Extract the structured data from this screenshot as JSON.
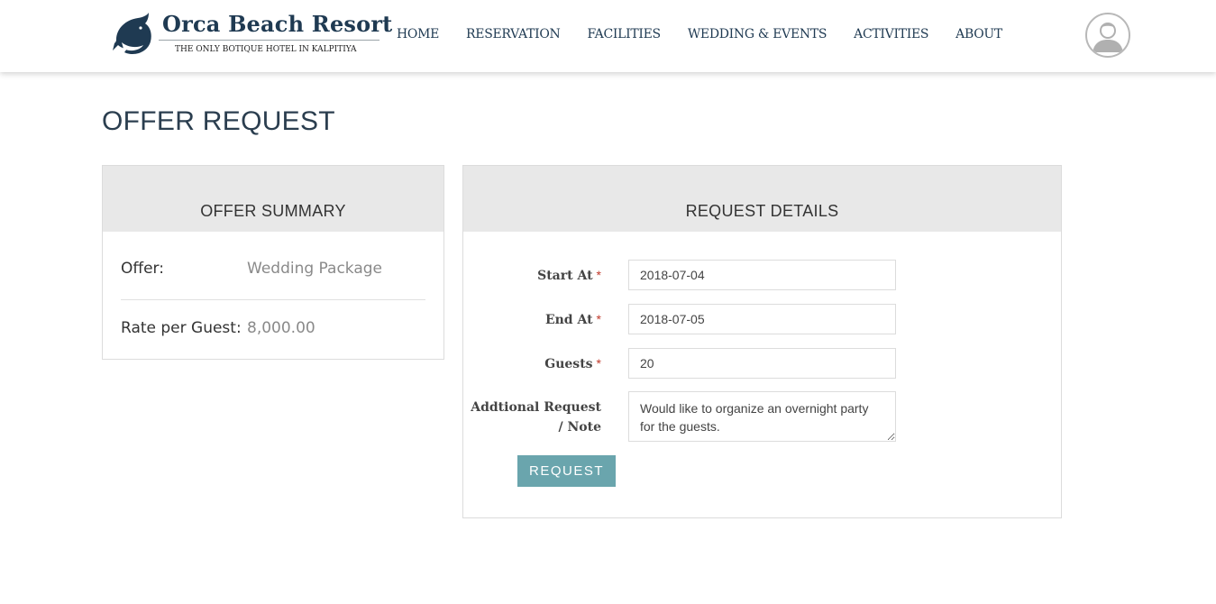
{
  "brand": {
    "name": "Orca Beach Resort",
    "tagline": "THE ONLY BOTIQUE HOTEL IN KALPITIYA",
    "logo_icon": "orca-whale-icon",
    "color": "#1f3a52"
  },
  "nav": {
    "items": [
      {
        "label": "HOME"
      },
      {
        "label": "RESERVATION"
      },
      {
        "label": "FACILITIES"
      },
      {
        "label": "WEDDING & EVENTS"
      },
      {
        "label": "ACTIVITIES"
      },
      {
        "label": "ABOUT"
      }
    ]
  },
  "user": {
    "avatar_icon": "user-avatar-icon"
  },
  "page": {
    "title": "OFFER REQUEST"
  },
  "summary": {
    "heading": "OFFER SUMMARY",
    "offer_label": "Offer:",
    "offer_value": "Wedding Package",
    "rate_label": "Rate per Guest:",
    "rate_value": "8,000.00"
  },
  "details": {
    "heading": "REQUEST DETAILS",
    "start_label": "Start At",
    "start_value": "2018-07-04",
    "end_label": "End At",
    "end_value": "2018-07-05",
    "guests_label": "Guests",
    "guests_value": "20",
    "note_label_1": "Addtional Request",
    "note_label_2": "/ Note",
    "note_value": "Would like to organize an overnight party for the guests.",
    "required_mark": "*",
    "submit_label": "REQUEST",
    "accent_color": "#6aa5ad",
    "required_color": "#c0392b"
  }
}
